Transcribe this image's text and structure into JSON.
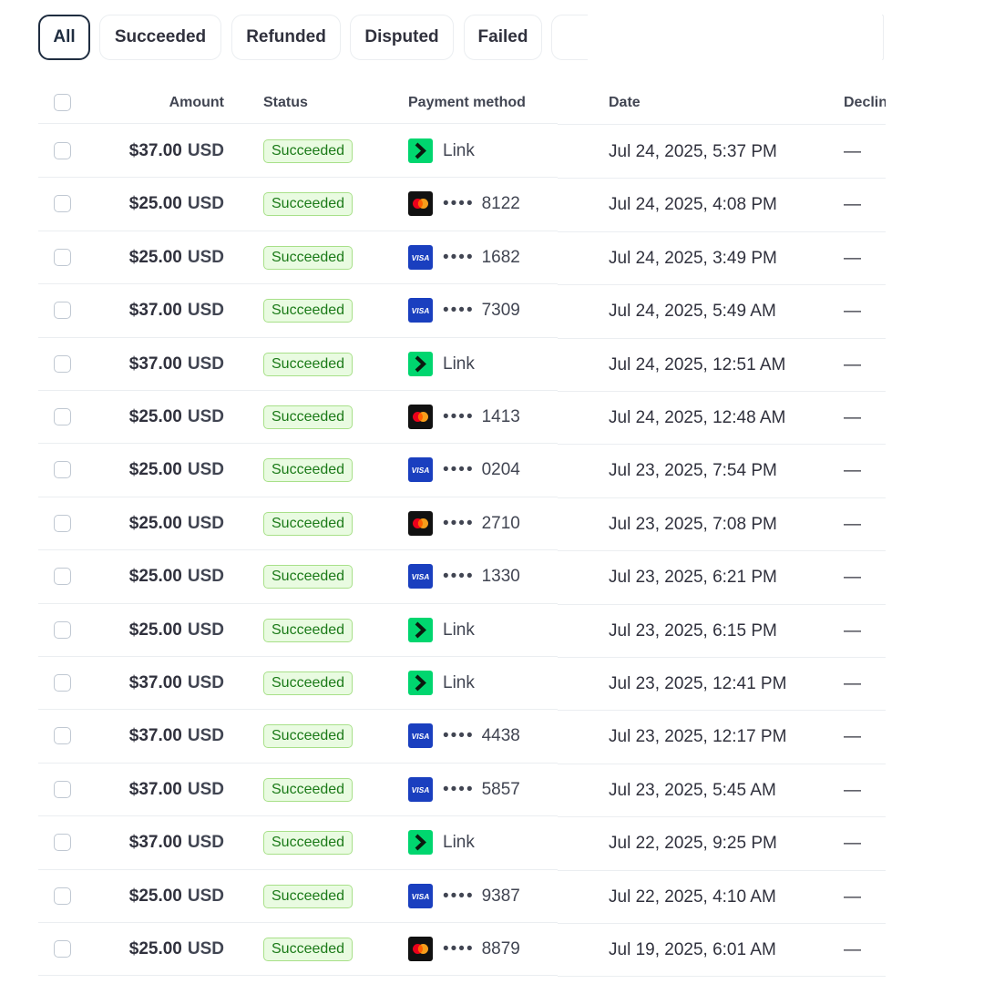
{
  "filters": [
    {
      "label": "All",
      "active": true
    },
    {
      "label": "Succeeded",
      "active": false
    },
    {
      "label": "Refunded",
      "active": false
    },
    {
      "label": "Disputed",
      "active": false
    },
    {
      "label": "Failed",
      "active": false
    }
  ],
  "table": {
    "headers": {
      "amount": "Amount",
      "status": "Status",
      "payment_method": "Payment method",
      "date": "Date",
      "declined": "Declin"
    },
    "rows": [
      {
        "amount": "$37.00",
        "currency": "USD",
        "status": "Succeeded",
        "pm_type": "link",
        "pm_text": "Link",
        "last4": "",
        "date": "Jul 24, 2025, 5:37 PM",
        "declined": "—"
      },
      {
        "amount": "$25.00",
        "currency": "USD",
        "status": "Succeeded",
        "pm_type": "mastercard",
        "pm_text": "",
        "last4": "8122",
        "date": "Jul 24, 2025, 4:08 PM",
        "declined": "—"
      },
      {
        "amount": "$25.00",
        "currency": "USD",
        "status": "Succeeded",
        "pm_type": "visa",
        "pm_text": "",
        "last4": "1682",
        "date": "Jul 24, 2025, 3:49 PM",
        "declined": "—"
      },
      {
        "amount": "$37.00",
        "currency": "USD",
        "status": "Succeeded",
        "pm_type": "visa",
        "pm_text": "",
        "last4": "7309",
        "date": "Jul 24, 2025, 5:49 AM",
        "declined": "—"
      },
      {
        "amount": "$37.00",
        "currency": "USD",
        "status": "Succeeded",
        "pm_type": "link",
        "pm_text": "Link",
        "last4": "",
        "date": "Jul 24, 2025, 12:51 AM",
        "declined": "—"
      },
      {
        "amount": "$25.00",
        "currency": "USD",
        "status": "Succeeded",
        "pm_type": "mastercard",
        "pm_text": "",
        "last4": "1413",
        "date": "Jul 24, 2025, 12:48 AM",
        "declined": "—"
      },
      {
        "amount": "$25.00",
        "currency": "USD",
        "status": "Succeeded",
        "pm_type": "visa",
        "pm_text": "",
        "last4": "0204",
        "date": "Jul 23, 2025, 7:54 PM",
        "declined": "—"
      },
      {
        "amount": "$25.00",
        "currency": "USD",
        "status": "Succeeded",
        "pm_type": "mastercard",
        "pm_text": "",
        "last4": "2710",
        "date": "Jul 23, 2025, 7:08 PM",
        "declined": "—"
      },
      {
        "amount": "$25.00",
        "currency": "USD",
        "status": "Succeeded",
        "pm_type": "visa",
        "pm_text": "",
        "last4": "1330",
        "date": "Jul 23, 2025, 6:21 PM",
        "declined": "—"
      },
      {
        "amount": "$25.00",
        "currency": "USD",
        "status": "Succeeded",
        "pm_type": "link",
        "pm_text": "Link",
        "last4": "",
        "date": "Jul 23, 2025, 6:15 PM",
        "declined": "—"
      },
      {
        "amount": "$37.00",
        "currency": "USD",
        "status": "Succeeded",
        "pm_type": "link",
        "pm_text": "Link",
        "last4": "",
        "date": "Jul 23, 2025, 12:41 PM",
        "declined": "—"
      },
      {
        "amount": "$37.00",
        "currency": "USD",
        "status": "Succeeded",
        "pm_type": "visa",
        "pm_text": "",
        "last4": "4438",
        "date": "Jul 23, 2025, 12:17 PM",
        "declined": "—"
      },
      {
        "amount": "$37.00",
        "currency": "USD",
        "status": "Succeeded",
        "pm_type": "visa",
        "pm_text": "",
        "last4": "5857",
        "date": "Jul 23, 2025, 5:45 AM",
        "declined": "—"
      },
      {
        "amount": "$37.00",
        "currency": "USD",
        "status": "Succeeded",
        "pm_type": "link",
        "pm_text": "Link",
        "last4": "",
        "date": "Jul 22, 2025, 9:25 PM",
        "declined": "—"
      },
      {
        "amount": "$25.00",
        "currency": "USD",
        "status": "Succeeded",
        "pm_type": "visa",
        "pm_text": "",
        "last4": "9387",
        "date": "Jul 22, 2025, 4:10 AM",
        "declined": "—"
      },
      {
        "amount": "$25.00",
        "currency": "USD",
        "status": "Succeeded",
        "pm_type": "mastercard",
        "pm_text": "",
        "last4": "8879",
        "date": "Jul 19, 2025, 6:01 AM",
        "declined": "—"
      }
    ]
  },
  "colors": {
    "active_border": "#1f2d40",
    "badge_bg": "#e9fbe1",
    "badge_border": "#a8e089",
    "badge_text": "#1b7a18",
    "link_green": "#00d66f",
    "visa_blue": "#1a3fbf",
    "mastercard_black": "#111111"
  },
  "icons": {
    "link": "link-pay-icon",
    "mastercard": "mastercard-icon",
    "visa": "visa-icon"
  }
}
